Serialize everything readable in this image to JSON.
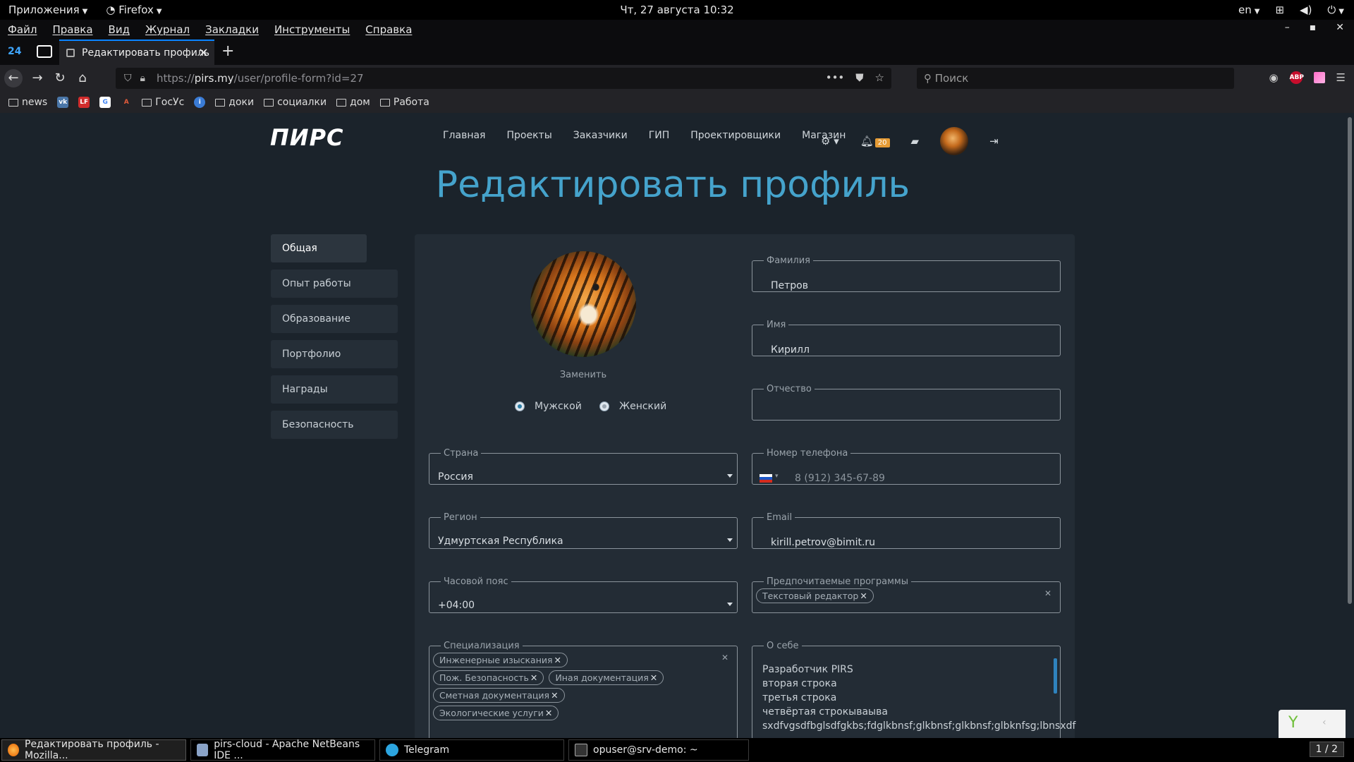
{
  "os_panel": {
    "apps_label": "Приложения",
    "browser_label": "Firefox",
    "datetime": "Чт, 27 августа  10:32",
    "lang": "en"
  },
  "menubar": {
    "items": [
      "Файл",
      "Правка",
      "Вид",
      "Журнал",
      "Закладки",
      "Инструменты",
      "Справка"
    ]
  },
  "tabs": {
    "counter": "24",
    "active_title": "Редактировать профиль"
  },
  "navbar": {
    "url_prefix": "https://",
    "url_host": "pirs.my",
    "url_path": "/user/profile-form?id=27",
    "search_placeholder": "Поиск",
    "abp": "ABP"
  },
  "bookmarks": [
    {
      "label": "news",
      "type": "folder"
    },
    {
      "label": "",
      "type": "vk"
    },
    {
      "label": "",
      "type": "lf"
    },
    {
      "label": "",
      "type": "g"
    },
    {
      "label": "",
      "type": "a"
    },
    {
      "label": "ГосУс",
      "type": "folder"
    },
    {
      "label": "",
      "type": "i"
    },
    {
      "label": "доки",
      "type": "folder"
    },
    {
      "label": "социалки",
      "type": "folder"
    },
    {
      "label": "дом",
      "type": "folder"
    },
    {
      "label": "Работа",
      "type": "folder"
    }
  ],
  "site": {
    "logo": "ПИРС",
    "nav": [
      "Главная",
      "Проекты",
      "Заказчики",
      "ГИП",
      "Проектировщики",
      "Магазин"
    ],
    "notifications_count": "20",
    "page_title": "Редактировать профиль",
    "sidebar": [
      "Общая",
      "Опыт работы",
      "Образование",
      "Портфолио",
      "Награды",
      "Безопасность"
    ],
    "avatar_replace": "Заменить",
    "gender": {
      "male": "Мужской",
      "female": "Женский",
      "selected": "male"
    },
    "fields": {
      "lastname": {
        "label": "Фамилия",
        "value": "Петров"
      },
      "firstname": {
        "label": "Имя",
        "value": "Кирилл"
      },
      "middlename": {
        "label": "Отчество",
        "value": ""
      },
      "phone": {
        "label": "Номер телефона",
        "placeholder": "8 (912) 345-67-89"
      },
      "email": {
        "label": "Email",
        "value": "kirill.petrov@bimit.ru"
      },
      "country": {
        "label": "Страна",
        "value": "Россия"
      },
      "region": {
        "label": "Регион",
        "value": "Удмуртская Республика"
      },
      "timezone": {
        "label": "Часовой пояс",
        "value": "+04:00"
      },
      "programs": {
        "label": "Предпочитаемые программы",
        "chips": [
          "Текстовый редактор"
        ]
      },
      "specialization": {
        "label": "Специализация",
        "chips": [
          "Инженерные изыскания",
          "Пож. Безопасность",
          "Иная документация",
          "Сметная документация",
          "Экологические услуги"
        ]
      },
      "about": {
        "label": "О себе",
        "text": "Разработчик PIRS\nвторая строка\nтретья строка\nчетвёртая строкываыва\nsxdfvgsdfbglsdfgkbs;fdglkbnsf;glkbnsf;glkbnsf;glbknfsg;lbnsxdf"
      }
    }
  },
  "taskbar": {
    "tasks": [
      "Редактировать профиль - Mozilla...",
      "pirs-cloud - Apache NetBeans IDE ...",
      "Telegram",
      "opuser@srv-demo: ~"
    ],
    "pager": "1 / 2"
  }
}
